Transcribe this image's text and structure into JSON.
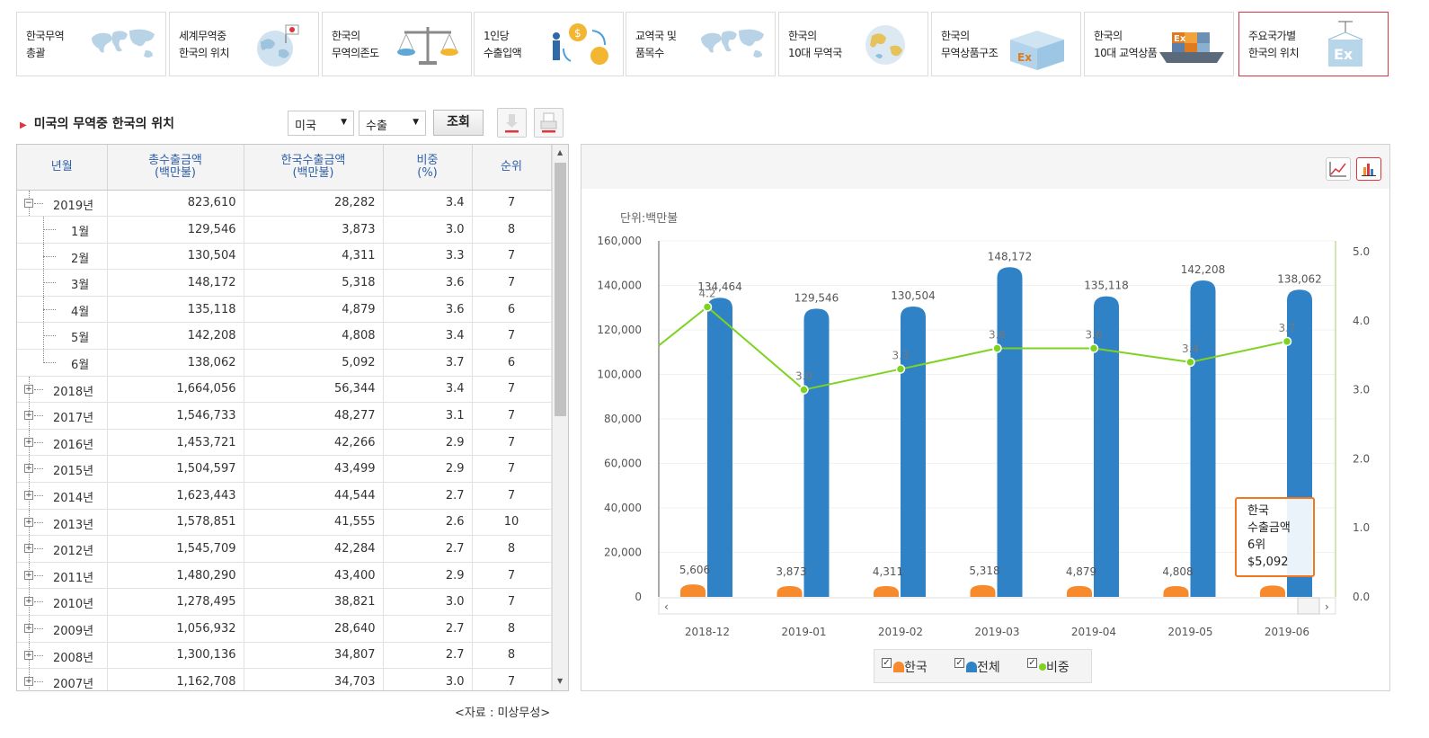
{
  "nav": {
    "items": [
      {
        "label": "한국무역\n총괄",
        "icon": "world-map-icon"
      },
      {
        "label": "세계무역중\n한국의 위치",
        "icon": "globe-flag-icon"
      },
      {
        "label": "한국의\n무역의존도",
        "icon": "scale-icon"
      },
      {
        "label": "1인당\n수출입액",
        "icon": "person-coins-icon"
      },
      {
        "label": "교역국 및\n품목수",
        "icon": "world-map-icon"
      },
      {
        "label": "한국의\n10대 무역국",
        "icon": "globe-icon"
      },
      {
        "label": "한국의\n무역상품구조",
        "icon": "box-icon"
      },
      {
        "label": "한국의\n10대 교역상품",
        "icon": "cargo-ship-icon"
      },
      {
        "label": "주요국가별\n한국의 위치",
        "icon": "container-crane-icon"
      }
    ],
    "active_index": 8
  },
  "toolbar": {
    "title": "미국의 무역중 한국의 위치",
    "country": "미국",
    "trade_type": "수출",
    "search_label": "조회",
    "download_icon": "download-icon",
    "print_icon": "print-icon"
  },
  "table": {
    "headers": [
      "년월",
      "총수출금액\n(백만불)",
      "한국수출금액\n(백만불)",
      "비중\n(%)",
      "순위"
    ],
    "rows": [
      {
        "ym": "2019년",
        "total": "823,610",
        "korea": "28,282",
        "share": "3.4",
        "rank": "7",
        "type": "year-open"
      },
      {
        "ym": "1월",
        "total": "129,546",
        "korea": "3,873",
        "share": "3.0",
        "rank": "8",
        "type": "child"
      },
      {
        "ym": "2월",
        "total": "130,504",
        "korea": "4,311",
        "share": "3.3",
        "rank": "7",
        "type": "child"
      },
      {
        "ym": "3월",
        "total": "148,172",
        "korea": "5,318",
        "share": "3.6",
        "rank": "7",
        "type": "child"
      },
      {
        "ym": "4월",
        "total": "135,118",
        "korea": "4,879",
        "share": "3.6",
        "rank": "6",
        "type": "child"
      },
      {
        "ym": "5월",
        "total": "142,208",
        "korea": "4,808",
        "share": "3.4",
        "rank": "7",
        "type": "child"
      },
      {
        "ym": "6월",
        "total": "138,062",
        "korea": "5,092",
        "share": "3.7",
        "rank": "6",
        "type": "child-last"
      },
      {
        "ym": "2018년",
        "total": "1,664,056",
        "korea": "56,344",
        "share": "3.4",
        "rank": "7",
        "type": "year"
      },
      {
        "ym": "2017년",
        "total": "1,546,733",
        "korea": "48,277",
        "share": "3.1",
        "rank": "7",
        "type": "year"
      },
      {
        "ym": "2016년",
        "total": "1,453,721",
        "korea": "42,266",
        "share": "2.9",
        "rank": "7",
        "type": "year"
      },
      {
        "ym": "2015년",
        "total": "1,504,597",
        "korea": "43,499",
        "share": "2.9",
        "rank": "7",
        "type": "year"
      },
      {
        "ym": "2014년",
        "total": "1,623,443",
        "korea": "44,544",
        "share": "2.7",
        "rank": "7",
        "type": "year"
      },
      {
        "ym": "2013년",
        "total": "1,578,851",
        "korea": "41,555",
        "share": "2.6",
        "rank": "10",
        "type": "year"
      },
      {
        "ym": "2012년",
        "total": "1,545,709",
        "korea": "42,284",
        "share": "2.7",
        "rank": "8",
        "type": "year"
      },
      {
        "ym": "2011년",
        "total": "1,480,290",
        "korea": "43,400",
        "share": "2.9",
        "rank": "7",
        "type": "year"
      },
      {
        "ym": "2010년",
        "total": "1,278,495",
        "korea": "38,821",
        "share": "3.0",
        "rank": "7",
        "type": "year"
      },
      {
        "ym": "2009년",
        "total": "1,056,932",
        "korea": "28,640",
        "share": "2.7",
        "rank": "8",
        "type": "year"
      },
      {
        "ym": "2008년",
        "total": "1,300,136",
        "korea": "34,807",
        "share": "2.7",
        "rank": "8",
        "type": "year"
      },
      {
        "ym": "2007년",
        "total": "1,162,708",
        "korea": "34,703",
        "share": "3.0",
        "rank": "7",
        "type": "year"
      }
    ]
  },
  "source": "<자료 : 미상무성>",
  "chart_controls": {
    "line_icon": "line-chart-icon",
    "bar_icon": "bar-chart-icon",
    "active": "bar"
  },
  "chart_data": {
    "type": "bar",
    "unit_label": "단위:백만불",
    "categories": [
      "2018-12",
      "2019-01",
      "2019-02",
      "2019-03",
      "2019-04",
      "2019-05",
      "2019-06"
    ],
    "series": [
      {
        "name": "한국",
        "values": [
          5606,
          3873,
          4311,
          5318,
          4879,
          4808,
          5092
        ],
        "labels": [
          "5,606",
          "3,873",
          "4,311",
          "5,318",
          "4,879",
          "4,808",
          ""
        ],
        "color": "#f68a2d"
      },
      {
        "name": "전체",
        "values": [
          134464,
          129546,
          130504,
          148172,
          135118,
          142208,
          138062
        ],
        "labels": [
          "134,464",
          "129,546",
          "130,504",
          "148,172",
          "135,118",
          "142,208",
          "138,062"
        ],
        "color": "#2f82c6"
      },
      {
        "name": "비중",
        "type": "line",
        "values": [
          4.2,
          3.0,
          3.3,
          3.6,
          3.6,
          3.4,
          3.7
        ],
        "labels": [
          "4.2",
          "3.0",
          "3.3",
          "3.6",
          "3.6",
          "3.4",
          "3.7"
        ],
        "color": "#7ed321"
      }
    ],
    "y_left": {
      "min": 0,
      "max": 160000,
      "ticks": [
        "0",
        "20,000",
        "40,000",
        "60,000",
        "80,000",
        "100,000",
        "120,000",
        "140,000",
        "160,000"
      ]
    },
    "y_right": {
      "min": 0,
      "max": 5.0,
      "ticks": [
        "0.0",
        "1.0",
        "2.0",
        "3.0",
        "4.0",
        "5.0"
      ]
    },
    "legend_position": "bottom"
  },
  "tooltip": {
    "line1": "한국",
    "line2": "수출금액",
    "line3": "6위",
    "line4": "$5,092"
  }
}
